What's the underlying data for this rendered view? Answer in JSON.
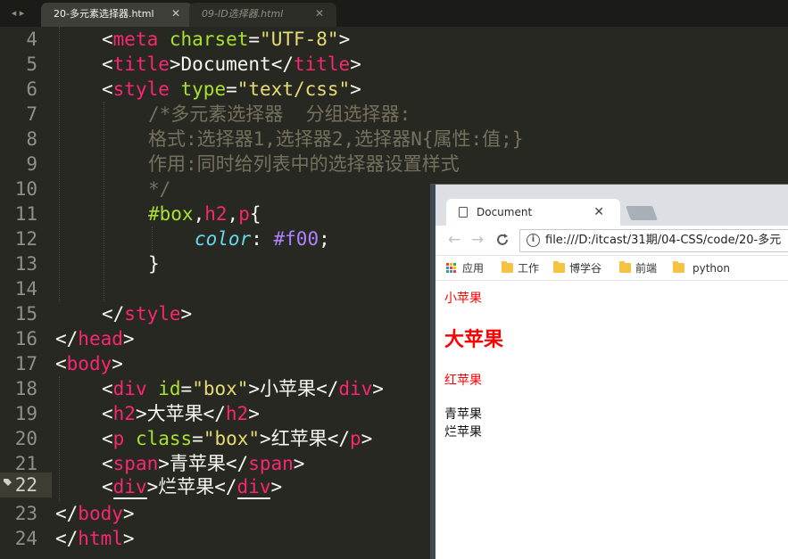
{
  "editor": {
    "nav_arrows": "◂ ▸",
    "tabs": [
      {
        "label": "20-多元素选择器.html",
        "close": "✕"
      },
      {
        "label": "09-ID选择器.html",
        "close": "✕"
      }
    ],
    "line_numbers": [
      "4",
      "5",
      "6",
      "7",
      "8",
      "9",
      "10",
      "11",
      "12",
      "13",
      "14",
      "15",
      "16",
      "17",
      "18",
      "19",
      "20",
      "21",
      "22",
      "23",
      "24"
    ],
    "current_line": "22",
    "code": {
      "l4": {
        "open": "<",
        "tag": "meta",
        "attr": " charset",
        "eq": "=",
        "val": "\"UTF-8\"",
        "close": ">"
      },
      "l5": {
        "o1": "<",
        "tag1": "title",
        "c1": ">",
        "text": "Document",
        "o2": "</",
        "tag2": "title",
        "c2": ">"
      },
      "l6": {
        "open": "<",
        "tag": "style",
        "attr": " type",
        "eq": "=",
        "val": "\"text/css\"",
        "close": ">"
      },
      "l7": "/*多元素选择器  分组选择器:",
      "l8": "格式:选择器1,选择器2,选择器N{属性:值;}",
      "l9": "作用:同时给列表中的选择器设置样式",
      "l10": "*/",
      "l11": {
        "sel1": "#box",
        "comma1": ",",
        "sel2": "h2",
        "comma2": ",",
        "sel3": "p",
        "brace": "{"
      },
      "l12": {
        "prop": "color",
        "colon": ": ",
        "val": "#f00",
        "semi": ";"
      },
      "l13": "}",
      "l15": {
        "open": "</",
        "tag": "style",
        "close": ">"
      },
      "l16": {
        "open": "</",
        "tag": "head",
        "close": ">"
      },
      "l17": {
        "open": "<",
        "tag": "body",
        "close": ">"
      },
      "l18": {
        "o1": "<",
        "tag1": "div",
        "attr": " id",
        "eq": "=",
        "val": "\"box\"",
        "c1": ">",
        "text": "小苹果",
        "o2": "</",
        "tag2": "div",
        "c2": ">"
      },
      "l19": {
        "o1": "<",
        "tag1": "h2",
        "c1": ">",
        "text": "大苹果",
        "o2": "</",
        "tag2": "h2",
        "c2": ">"
      },
      "l20": {
        "o1": "<",
        "tag1": "p",
        "attr": " class",
        "eq": "=",
        "val": "\"box\"",
        "c1": ">",
        "text": "红苹果",
        "o2": "</",
        "tag2": "p",
        "c2": ">"
      },
      "l21": {
        "o1": "<",
        "tag1": "span",
        "c1": ">",
        "text": "青苹果",
        "o2": "</",
        "tag2": "span",
        "c2": ">"
      },
      "l22": {
        "o1": "<",
        "tag1": "div",
        "c1": ">",
        "text": "烂苹果",
        "o2": "</",
        "tag2": "div",
        "c2": ">"
      },
      "l23": {
        "open": "</",
        "tag": "body",
        "close": ">"
      },
      "l24": {
        "open": "</",
        "tag": "html",
        "close": ">"
      }
    }
  },
  "browser": {
    "tab_title": "Document",
    "tab_close": "✕",
    "back": "←",
    "forward": "→",
    "reload": "C",
    "info_icon_glyph": "i",
    "url": "file:///D:/itcast/31期/04-CSS/code/20-多元",
    "bookmarks": {
      "apps": "应用",
      "work": "工作",
      "boxue": "博学谷",
      "frontend": "前端",
      "python": "python"
    },
    "page": {
      "div_box": "小苹果",
      "h2": "大苹果",
      "p_box": "红苹果",
      "span": "青苹果",
      "div_plain": "烂苹果"
    }
  },
  "colors": {
    "editor_bg": "#272822",
    "tag": "#f92672",
    "attr": "#a6e22e",
    "string": "#e6db74",
    "comment": "#75715e",
    "property": "#66d9ef",
    "number": "#ae81ff",
    "page_red": "#ff0000"
  }
}
